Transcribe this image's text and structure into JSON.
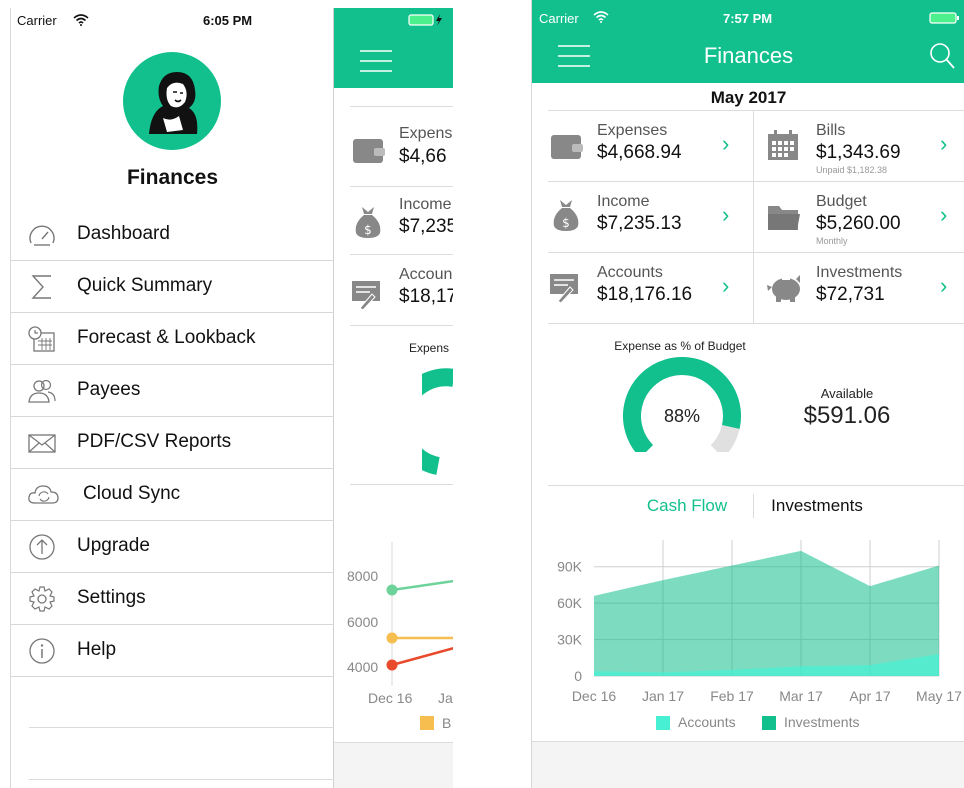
{
  "left": {
    "status": {
      "carrier": "Carrier",
      "time": "6:05 PM"
    },
    "drawer": {
      "title": "Finances",
      "menu": [
        {
          "label": "Dashboard",
          "icon": "speedometer-icon"
        },
        {
          "label": "Quick Summary",
          "icon": "sigma-icon"
        },
        {
          "label": "Forecast & Lookback",
          "icon": "calendar-clock-icon"
        },
        {
          "label": "Payees",
          "icon": "people-icon"
        },
        {
          "label": "PDF/CSV Reports",
          "icon": "envelope-icon"
        },
        {
          "label": "Cloud Sync",
          "icon": "cloud-sync-icon"
        },
        {
          "label": "Upgrade",
          "icon": "upgrade-arrow-icon"
        },
        {
          "label": "Settings",
          "icon": "gear-icon"
        },
        {
          "label": "Help",
          "icon": "info-icon"
        }
      ]
    },
    "behind": {
      "tiles": [
        {
          "label": "Expens",
          "value": "$4,66"
        },
        {
          "label": "Income",
          "value": "$7,235"
        },
        {
          "label": "Accoun",
          "value": "$18,17"
        }
      ],
      "gauge_title": "Expens",
      "y_ticks": [
        "8000",
        "6000",
        "4000"
      ],
      "x_ticks": [
        "Dec 16",
        "Ja"
      ],
      "legend_fragment": "B",
      "colors": {
        "green": "#6dd39a",
        "yellow": "#f6bd4f",
        "red": "#e94a2c"
      }
    }
  },
  "right": {
    "status": {
      "carrier": "Carrier",
      "time": "7:57 PM"
    },
    "header": {
      "title": "Finances"
    },
    "month": "May 2017",
    "tiles": [
      {
        "label": "Expenses",
        "value": "$4,668.94",
        "sub": "",
        "icon": "wallet-icon"
      },
      {
        "label": "Bills",
        "value": "$1,343.69",
        "sub": "Unpaid $1,182.38",
        "icon": "calendar-icon"
      },
      {
        "label": "Income",
        "value": "$7,235.13",
        "sub": "",
        "icon": "money-bag-icon"
      },
      {
        "label": "Budget",
        "value": "$5,260.00",
        "sub": "Monthly",
        "icon": "folder-icon"
      },
      {
        "label": "Accounts",
        "value": "$18,176.16",
        "sub": "",
        "icon": "ledger-icon"
      },
      {
        "label": "Investments",
        "value": "$72,731",
        "sub": "",
        "icon": "piggy-bank-icon"
      }
    ],
    "gauge": {
      "title": "Expense as % of Budget",
      "percent_label": "88%",
      "percent": 88,
      "available_label": "Available",
      "available_value": "$591.06"
    },
    "tabs": {
      "active": "Cash Flow",
      "inactive": "Investments"
    },
    "colors": {
      "accent": "#12c08d",
      "accounts": "#48f0d3",
      "investments": "#12c08d"
    }
  },
  "chart_data": {
    "type": "area",
    "x": [
      "Dec 16",
      "Jan 17",
      "Feb 17",
      "Mar 17",
      "Apr 17",
      "May 17"
    ],
    "y_ticks": [
      "0",
      "30K",
      "60K",
      "90K"
    ],
    "ylim": [
      0,
      112000
    ],
    "series": [
      {
        "name": "Accounts",
        "values": [
          4000,
          3000,
          5000,
          8000,
          9000,
          18000
        ]
      },
      {
        "name": "Investments",
        "values": [
          66000,
          79000,
          91000,
          103000,
          74000,
          91000
        ]
      }
    ]
  }
}
